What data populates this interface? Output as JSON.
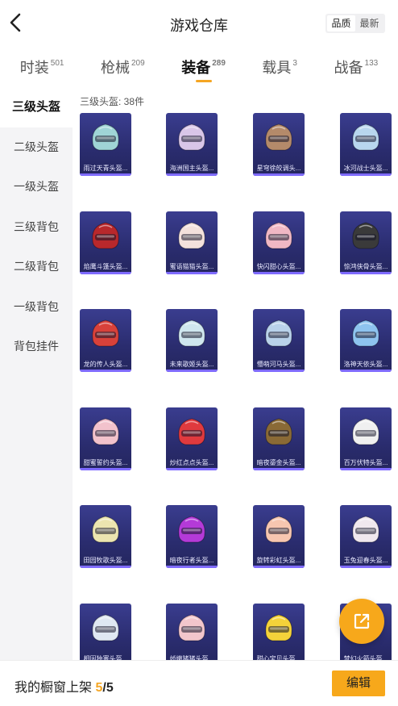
{
  "header": {
    "title": "游戏仓库",
    "sort_options": [
      "品质",
      "最新"
    ],
    "sort_selected": 0
  },
  "tabs": [
    {
      "label": "时装",
      "count": "501"
    },
    {
      "label": "枪械",
      "count": "209"
    },
    {
      "label": "装备",
      "count": "289",
      "active": true
    },
    {
      "label": "载具",
      "count": "3"
    },
    {
      "label": "战备",
      "count": "133"
    }
  ],
  "sidebar": {
    "items": [
      "三级头盔",
      "二级头盔",
      "一级头盔",
      "三级背包",
      "二级背包",
      "一级背包",
      "背包挂件"
    ],
    "selected": 0
  },
  "main": {
    "count_label": "三级头盔: 38件",
    "items": [
      {
        "name": "雨过天青头盔...",
        "color": "#9fd4d6"
      },
      {
        "name": "海洲国主头盔...",
        "color": "#d9c6e8"
      },
      {
        "name": "星穹徐皎调头...",
        "color": "#b48a6a"
      },
      {
        "name": "冰河战士头盔...",
        "color": "#b8d6ee"
      },
      {
        "name": "焰鹰斗篷头盔...",
        "color": "#b8282c"
      },
      {
        "name": "蜜语猫猫头盔...",
        "color": "#f3e1dc"
      },
      {
        "name": "快闪甜心头盔...",
        "color": "#f0b8c4"
      },
      {
        "name": "惊鸿侠骨头盔...",
        "color": "#3a3a3a"
      },
      {
        "name": "龙的传人头盔...",
        "color": "#d8413a"
      },
      {
        "name": "未来歌姬头盔...",
        "color": "#cfe6ee"
      },
      {
        "name": "懵萌河马头盔...",
        "color": "#b9d2ea"
      },
      {
        "name": "洛神天依头盔...",
        "color": "#8ec3ef"
      },
      {
        "name": "甜蜜誓约头盔...",
        "color": "#f2c2cc"
      },
      {
        "name": "炒红点点头盔...",
        "color": "#e03a3e"
      },
      {
        "name": "暗夜鎏金头盔...",
        "color": "#8a6a36"
      },
      {
        "name": "百万伏特头盔...",
        "color": "#f0f0f0"
      },
      {
        "name": "田园牧歌头盔...",
        "color": "#ece5b0"
      },
      {
        "name": "暗夜行者头盔...",
        "color": "#b43ad8"
      },
      {
        "name": "旋转彩虹头盔...",
        "color": "#f7c6b0"
      },
      {
        "name": "玉兔迎春头盔...",
        "color": "#f0e8ee"
      },
      {
        "name": "相因独寒头盔...",
        "color": "#dfe8f2"
      },
      {
        "name": "娇嫩猪猪头盔...",
        "color": "#f2c6cc"
      },
      {
        "name": "甜心宝贝头盔...",
        "color": "#f4d23a"
      },
      {
        "name": "梦幻火箭头盔...",
        "color": "#8ac6ef"
      }
    ]
  },
  "footer": {
    "showcase_label": "我的橱窗上架",
    "current": "5",
    "slash": "/",
    "total": "5",
    "edit_label": "编辑"
  },
  "colors": {
    "accent": "#f7a81b",
    "card_bg": "#2f3178",
    "card_stripe": "#7f6bff"
  }
}
